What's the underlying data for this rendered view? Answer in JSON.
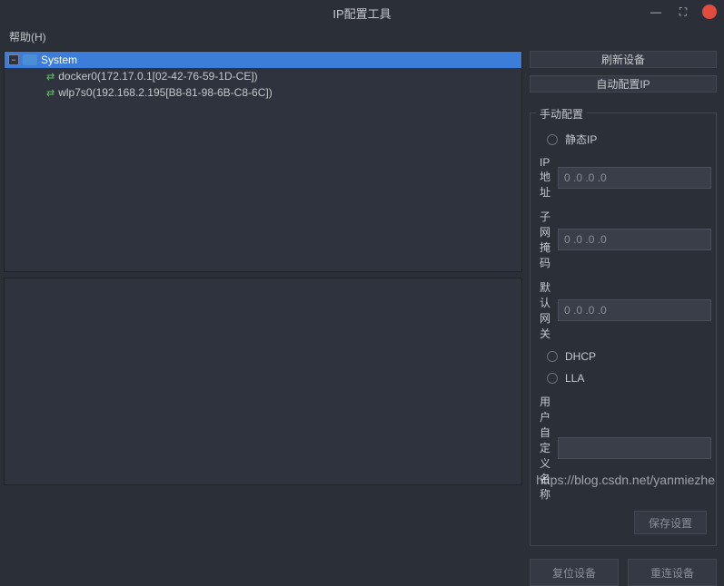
{
  "window": {
    "title": "IP配置工具",
    "minimize": "—",
    "maximize": "⛶",
    "close": "×"
  },
  "menubar": {
    "help": "帮助(H)"
  },
  "tree": {
    "root": {
      "label": "System",
      "toggle": "−"
    },
    "children": [
      {
        "label": "docker0(172.17.0.1[02-42-76-59-1D-CE])"
      },
      {
        "label": "wlp7s0(192.168.2.195[B8-81-98-6B-C8-6C])"
      }
    ]
  },
  "buttons": {
    "refresh": "刷新设备",
    "autoconfig": "自动配置IP",
    "reset": "复位设备",
    "reconnect": "重连设备",
    "save": "保存设置"
  },
  "manual": {
    "title": "手动配置",
    "static_ip": "静态IP",
    "ip_label": "IP地址",
    "ip_value": "0 .0 .0 .0",
    "mask_label": "子网掩码",
    "mask_value": "0 .0 .0 .0",
    "gateway_label": "默认网关",
    "gateway_value": "0 .0 .0 .0",
    "dhcp": "DHCP",
    "lla": "LLA",
    "custom_name_label": "用户自定义名称",
    "custom_name_value": ""
  },
  "watermark": "https://blog.csdn.net/yanmiezhe"
}
